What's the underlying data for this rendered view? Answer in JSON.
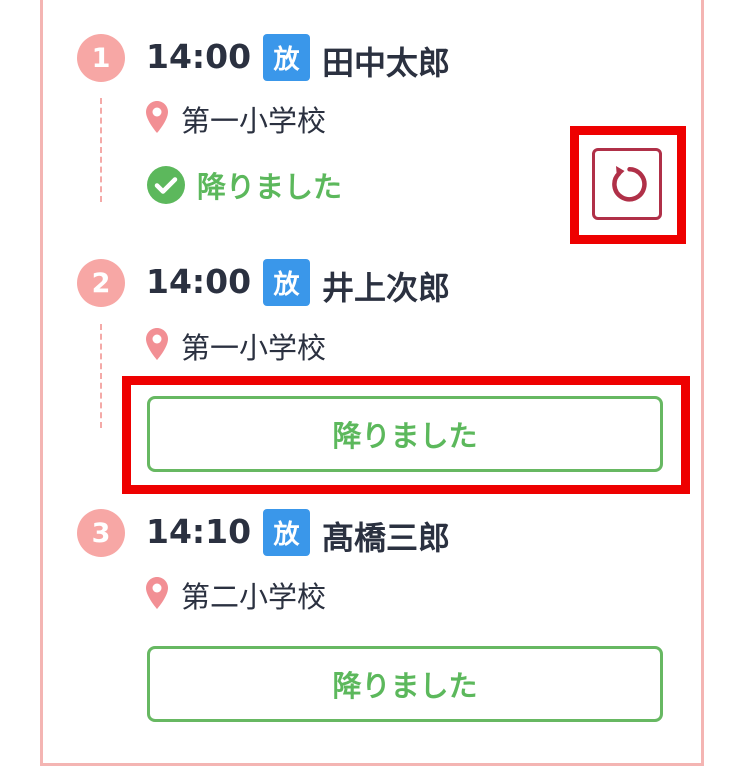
{
  "stops": [
    {
      "number": "1",
      "time": "14:00",
      "tag": "放",
      "name": "田中太郎",
      "school": "第一小学校",
      "status": "降りました"
    },
    {
      "number": "2",
      "time": "14:00",
      "tag": "放",
      "name": "井上次郎",
      "school": "第一小学校",
      "button": "降りました"
    },
    {
      "number": "3",
      "time": "14:10",
      "tag": "放",
      "name": "髙橋三郎",
      "school": "第二小学校",
      "button": "降りました"
    }
  ],
  "colors": {
    "accent_green": "#5cb85c",
    "tag_blue": "#3a97ea",
    "number_pink": "#f7a7a5",
    "undo_red": "#b03048",
    "highlight_red": "#ee0000"
  },
  "icons": [
    "location-pin-icon",
    "check-circle-icon",
    "undo-icon"
  ]
}
